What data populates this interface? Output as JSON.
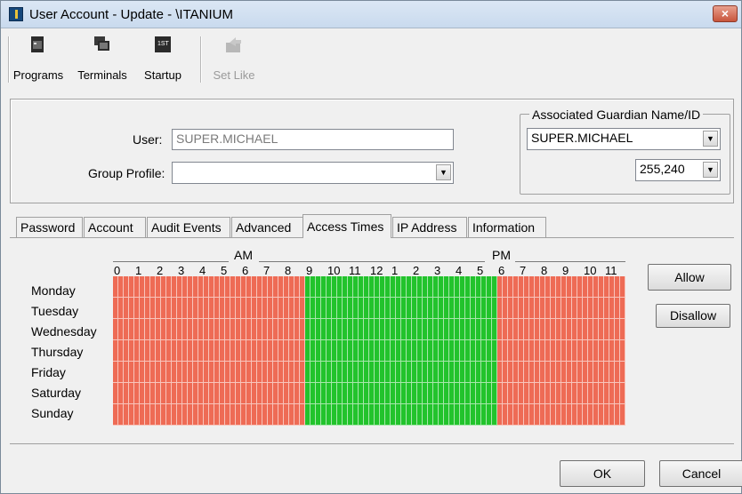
{
  "window": {
    "title": "User Account - Update - \\ITANIUM",
    "close_symbol": "×"
  },
  "toolbar": {
    "buttons": [
      {
        "label": "Programs",
        "icon": "programs-icon",
        "enabled": true
      },
      {
        "label": "Terminals",
        "icon": "terminals-icon",
        "enabled": true
      },
      {
        "label": "Startup",
        "icon": "startup-icon",
        "enabled": true
      },
      {
        "label": "Set Like",
        "icon": "set-like-icon",
        "enabled": false
      }
    ]
  },
  "form": {
    "user_label": "User:",
    "user_value": "SUPER.MICHAEL",
    "group_profile_label": "Group Profile:",
    "group_profile_value": "",
    "guardian_legend": "Associated Guardian Name/ID",
    "guardian_name": "SUPER.MICHAEL",
    "guardian_id": "255,240"
  },
  "tabs": [
    {
      "label": "Password",
      "active": false
    },
    {
      "label": "Account",
      "active": false
    },
    {
      "label": "Audit Events",
      "active": false
    },
    {
      "label": "Advanced",
      "active": false
    },
    {
      "label": "Access Times",
      "active": true
    },
    {
      "label": "IP Address",
      "active": false
    },
    {
      "label": "Information",
      "active": false
    }
  ],
  "access_times": {
    "am_label": "AM",
    "pm_label": "PM",
    "hour_labels": [
      "0",
      "1",
      "2",
      "3",
      "4",
      "5",
      "6",
      "7",
      "8",
      "9",
      "10",
      "11",
      "12",
      "1",
      "2",
      "3",
      "4",
      "5",
      "6",
      "7",
      "8",
      "9",
      "10",
      "11"
    ],
    "days": [
      "Monday",
      "Tuesday",
      "Wednesday",
      "Thursday",
      "Friday",
      "Saturday",
      "Sunday"
    ],
    "allowed_from_hour": 9,
    "allowed_to_hour": 18,
    "slots_per_hour": 4,
    "allowed_color": "#22c32c",
    "disallowed_color": "#ee6b55",
    "allow_button": "Allow",
    "disallow_button": "Disallow"
  },
  "footer": {
    "ok_button": "OK",
    "cancel_button": "Cancel"
  }
}
